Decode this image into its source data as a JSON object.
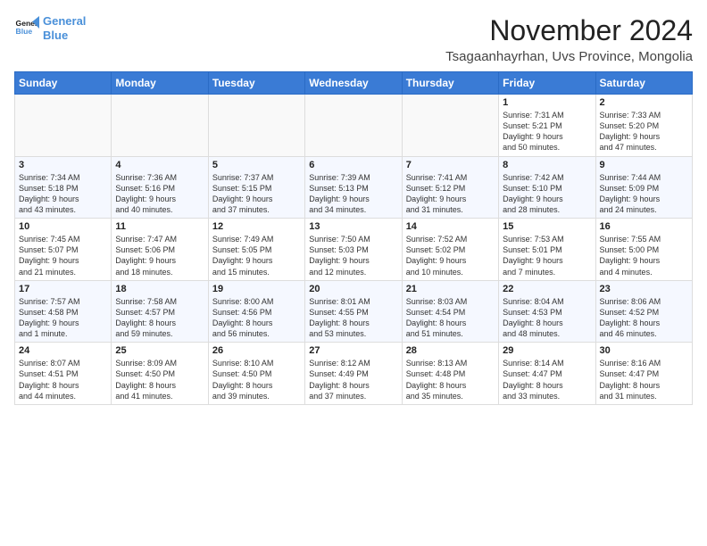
{
  "logo": {
    "line1": "General",
    "line2": "Blue"
  },
  "title": "November 2024",
  "location": "Tsagaanhayrhan, Uvs Province, Mongolia",
  "weekdays": [
    "Sunday",
    "Monday",
    "Tuesday",
    "Wednesday",
    "Thursday",
    "Friday",
    "Saturday"
  ],
  "weeks": [
    [
      {
        "day": "",
        "detail": ""
      },
      {
        "day": "",
        "detail": ""
      },
      {
        "day": "",
        "detail": ""
      },
      {
        "day": "",
        "detail": ""
      },
      {
        "day": "",
        "detail": ""
      },
      {
        "day": "1",
        "detail": "Sunrise: 7:31 AM\nSunset: 5:21 PM\nDaylight: 9 hours\nand 50 minutes."
      },
      {
        "day": "2",
        "detail": "Sunrise: 7:33 AM\nSunset: 5:20 PM\nDaylight: 9 hours\nand 47 minutes."
      }
    ],
    [
      {
        "day": "3",
        "detail": "Sunrise: 7:34 AM\nSunset: 5:18 PM\nDaylight: 9 hours\nand 43 minutes."
      },
      {
        "day": "4",
        "detail": "Sunrise: 7:36 AM\nSunset: 5:16 PM\nDaylight: 9 hours\nand 40 minutes."
      },
      {
        "day": "5",
        "detail": "Sunrise: 7:37 AM\nSunset: 5:15 PM\nDaylight: 9 hours\nand 37 minutes."
      },
      {
        "day": "6",
        "detail": "Sunrise: 7:39 AM\nSunset: 5:13 PM\nDaylight: 9 hours\nand 34 minutes."
      },
      {
        "day": "7",
        "detail": "Sunrise: 7:41 AM\nSunset: 5:12 PM\nDaylight: 9 hours\nand 31 minutes."
      },
      {
        "day": "8",
        "detail": "Sunrise: 7:42 AM\nSunset: 5:10 PM\nDaylight: 9 hours\nand 28 minutes."
      },
      {
        "day": "9",
        "detail": "Sunrise: 7:44 AM\nSunset: 5:09 PM\nDaylight: 9 hours\nand 24 minutes."
      }
    ],
    [
      {
        "day": "10",
        "detail": "Sunrise: 7:45 AM\nSunset: 5:07 PM\nDaylight: 9 hours\nand 21 minutes."
      },
      {
        "day": "11",
        "detail": "Sunrise: 7:47 AM\nSunset: 5:06 PM\nDaylight: 9 hours\nand 18 minutes."
      },
      {
        "day": "12",
        "detail": "Sunrise: 7:49 AM\nSunset: 5:05 PM\nDaylight: 9 hours\nand 15 minutes."
      },
      {
        "day": "13",
        "detail": "Sunrise: 7:50 AM\nSunset: 5:03 PM\nDaylight: 9 hours\nand 12 minutes."
      },
      {
        "day": "14",
        "detail": "Sunrise: 7:52 AM\nSunset: 5:02 PM\nDaylight: 9 hours\nand 10 minutes."
      },
      {
        "day": "15",
        "detail": "Sunrise: 7:53 AM\nSunset: 5:01 PM\nDaylight: 9 hours\nand 7 minutes."
      },
      {
        "day": "16",
        "detail": "Sunrise: 7:55 AM\nSunset: 5:00 PM\nDaylight: 9 hours\nand 4 minutes."
      }
    ],
    [
      {
        "day": "17",
        "detail": "Sunrise: 7:57 AM\nSunset: 4:58 PM\nDaylight: 9 hours\nand 1 minute."
      },
      {
        "day": "18",
        "detail": "Sunrise: 7:58 AM\nSunset: 4:57 PM\nDaylight: 8 hours\nand 59 minutes."
      },
      {
        "day": "19",
        "detail": "Sunrise: 8:00 AM\nSunset: 4:56 PM\nDaylight: 8 hours\nand 56 minutes."
      },
      {
        "day": "20",
        "detail": "Sunrise: 8:01 AM\nSunset: 4:55 PM\nDaylight: 8 hours\nand 53 minutes."
      },
      {
        "day": "21",
        "detail": "Sunrise: 8:03 AM\nSunset: 4:54 PM\nDaylight: 8 hours\nand 51 minutes."
      },
      {
        "day": "22",
        "detail": "Sunrise: 8:04 AM\nSunset: 4:53 PM\nDaylight: 8 hours\nand 48 minutes."
      },
      {
        "day": "23",
        "detail": "Sunrise: 8:06 AM\nSunset: 4:52 PM\nDaylight: 8 hours\nand 46 minutes."
      }
    ],
    [
      {
        "day": "24",
        "detail": "Sunrise: 8:07 AM\nSunset: 4:51 PM\nDaylight: 8 hours\nand 44 minutes."
      },
      {
        "day": "25",
        "detail": "Sunrise: 8:09 AM\nSunset: 4:50 PM\nDaylight: 8 hours\nand 41 minutes."
      },
      {
        "day": "26",
        "detail": "Sunrise: 8:10 AM\nSunset: 4:50 PM\nDaylight: 8 hours\nand 39 minutes."
      },
      {
        "day": "27",
        "detail": "Sunrise: 8:12 AM\nSunset: 4:49 PM\nDaylight: 8 hours\nand 37 minutes."
      },
      {
        "day": "28",
        "detail": "Sunrise: 8:13 AM\nSunset: 4:48 PM\nDaylight: 8 hours\nand 35 minutes."
      },
      {
        "day": "29",
        "detail": "Sunrise: 8:14 AM\nSunset: 4:47 PM\nDaylight: 8 hours\nand 33 minutes."
      },
      {
        "day": "30",
        "detail": "Sunrise: 8:16 AM\nSunset: 4:47 PM\nDaylight: 8 hours\nand 31 minutes."
      }
    ]
  ]
}
